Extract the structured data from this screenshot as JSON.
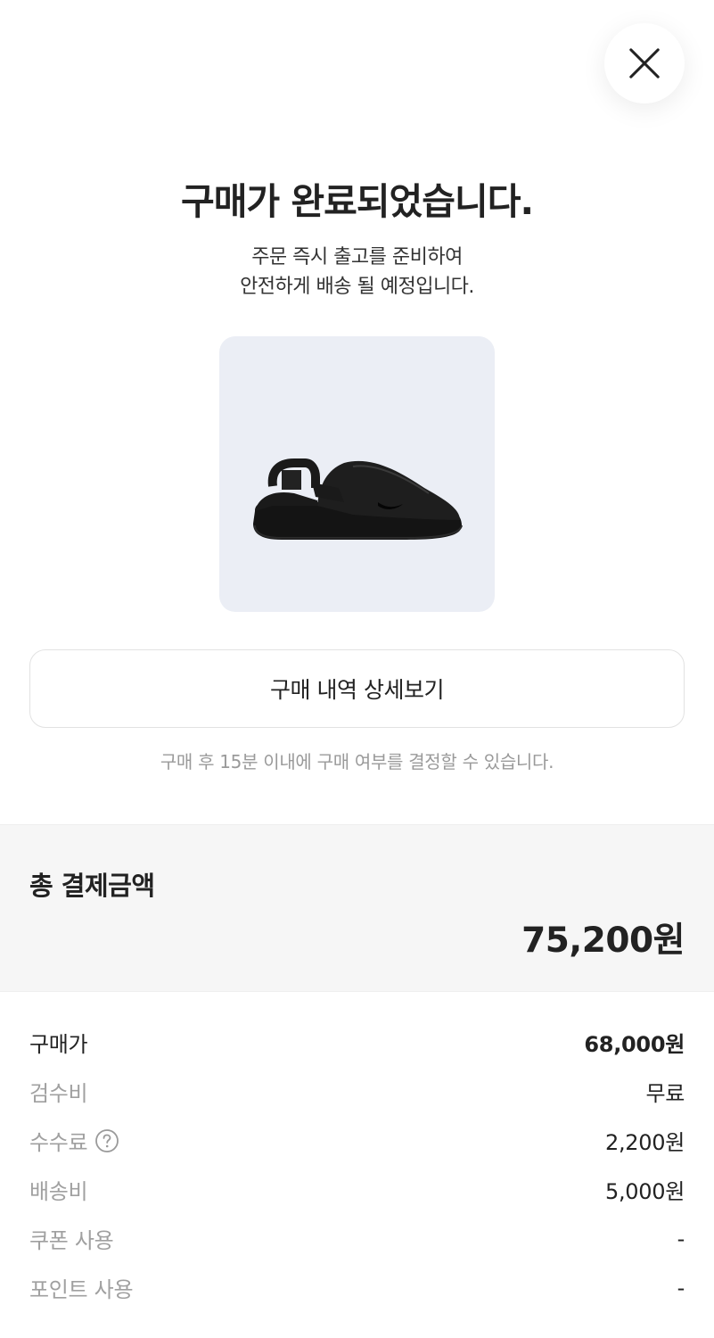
{
  "header": {
    "close_icon": "close-icon"
  },
  "confirmation": {
    "title": "구매가 완료되었습니다.",
    "subtitle_line1": "주문 즉시 출고를 준비하여",
    "subtitle_line2": "안전하게 배송 될 예정입니다."
  },
  "product": {
    "image_icon": "clog-sandal-image",
    "card_color": "#ebeef5"
  },
  "actions": {
    "detail_button_label": "구매 내역 상세보기",
    "notice": "구매 후 15분 이내에 구매 여부를 결정할 수 있습니다."
  },
  "total": {
    "label": "총 결제금액",
    "value": "75,200원"
  },
  "breakdown": [
    {
      "label": "구매가",
      "value": "68,000원"
    },
    {
      "label": "검수비",
      "value": "무료"
    },
    {
      "label": "수수료",
      "value": "2,200원"
    },
    {
      "label": "배송비",
      "value": "5,000원"
    },
    {
      "label": "쿠폰 사용",
      "value": "-"
    },
    {
      "label": "포인트 사용",
      "value": "-"
    }
  ]
}
